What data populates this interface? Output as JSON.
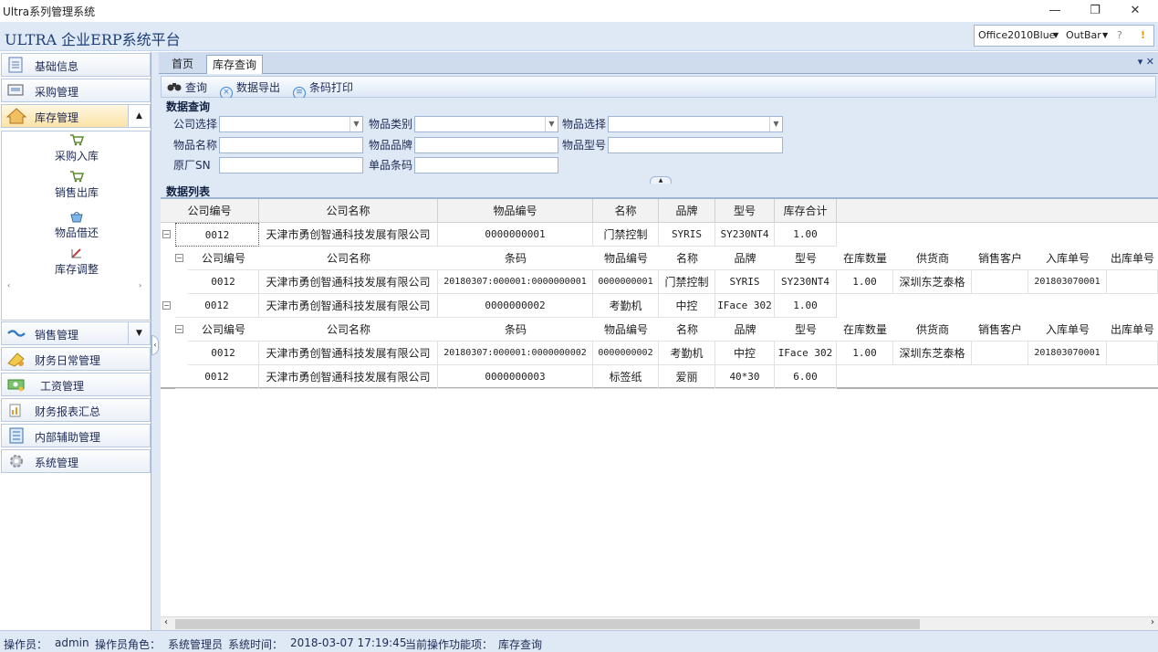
{
  "window": {
    "title": "Ultra系列管理系统",
    "minimize": "—",
    "restore": "❐",
    "close": "✕"
  },
  "app": {
    "title": "ULTRA  企业ERP系统平台",
    "skin": "Office2010Blue",
    "bar": "OutBar"
  },
  "sidebar": {
    "items": [
      {
        "label": "基础信息"
      },
      {
        "label": "采购管理"
      },
      {
        "label": "库存管理"
      },
      {
        "label": "销售管理"
      },
      {
        "label": "财务日常管理"
      },
      {
        "label": "工资管理"
      },
      {
        "label": "财务报表汇总"
      },
      {
        "label": "内部辅助管理"
      },
      {
        "label": "系统管理"
      }
    ],
    "sub_items": [
      {
        "label": "采购入库"
      },
      {
        "label": "销售出库"
      },
      {
        "label": "物品借还"
      },
      {
        "label": "库存调整"
      }
    ]
  },
  "tabs": [
    {
      "label": "首页"
    },
    {
      "label": "库存查询"
    }
  ],
  "toolbar": {
    "query": "查询",
    "export": "数据导出",
    "barcode": "条码打印"
  },
  "query": {
    "section": "数据查询",
    "fields": {
      "company": "公司选择",
      "category": "物品类别",
      "item_select": "物品选择",
      "item_name": "物品名称",
      "brand": "物品品牌",
      "model": "物品型号",
      "sn": "原厂SN",
      "barcode": "单品条码"
    }
  },
  "list": {
    "section": "数据列表",
    "headers": [
      "公司编号",
      "公司名称",
      "物品编号",
      "名称",
      "品牌",
      "型号",
      "库存合计"
    ],
    "detail_headers": [
      "公司编号",
      "公司名称",
      "条码",
      "物品编号",
      "名称",
      "品牌",
      "型号",
      "在库数量",
      "供货商",
      "销售客户",
      "入库单号",
      "出库单号"
    ],
    "rows": [
      {
        "company_id": "0012",
        "company": "天津市勇创智通科技发展有限公司",
        "item_id": "0000000001",
        "name": "门禁控制",
        "brand": "SYRIS",
        "model": "SY230NT4",
        "total": "1.00",
        "detail": {
          "company_id": "0012",
          "company": "天津市勇创智通科技发展有限公司",
          "barcode": "20180307:000001:0000000001",
          "item_id": "0000000001",
          "name": "门禁控制",
          "brand": "SYRIS",
          "model": "SY230NT4",
          "qty": "1.00",
          "supplier": "深圳东芝泰格",
          "customer": "",
          "in_no": "201803070001",
          "out_no": ""
        }
      },
      {
        "company_id": "0012",
        "company": "天津市勇创智通科技发展有限公司",
        "item_id": "0000000002",
        "name": "考勤机",
        "brand": "中控",
        "model": "IFace 302",
        "total": "1.00",
        "detail": {
          "company_id": "0012",
          "company": "天津市勇创智通科技发展有限公司",
          "barcode": "20180307:000001:0000000002",
          "item_id": "0000000002",
          "name": "考勤机",
          "brand": "中控",
          "model": "IFace 302",
          "qty": "1.00",
          "supplier": "深圳东芝泰格",
          "customer": "",
          "in_no": "201803070001",
          "out_no": ""
        }
      },
      {
        "company_id": "0012",
        "company": "天津市勇创智通科技发展有限公司",
        "item_id": "0000000003",
        "name": "标签纸",
        "brand": "爱丽",
        "model": "40*30",
        "total": "6.00"
      }
    ]
  },
  "status": {
    "operator_label": "操作员：",
    "operator": "admin",
    "role_label": "操作员角色：",
    "role": "系统管理员",
    "time_label": "系统时间：",
    "time": "2018-03-07 17:19:45",
    "func_label": "当前操作功能项：",
    "func": "库存查询"
  },
  "colors": {
    "accent": "#1d3f7a",
    "panel": "#dfe9f5",
    "border": "#9fb5d3"
  }
}
